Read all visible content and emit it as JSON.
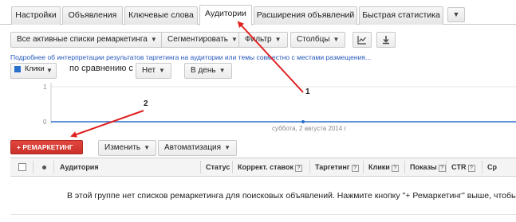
{
  "tabs": [
    {
      "label": "Настройки",
      "active": false
    },
    {
      "label": "Объявления",
      "active": false
    },
    {
      "label": "Ключевые слова",
      "active": false
    },
    {
      "label": "Аудитории",
      "active": true
    },
    {
      "label": "Расширения объявлений",
      "active": false
    },
    {
      "label": "Быстрая статистика",
      "active": false
    }
  ],
  "toolbar": {
    "filter_select": "Все активные списки ремаркетинга",
    "segment_label": "Сегментировать",
    "filter_label": "Фильтр",
    "columns_label": "Столбцы"
  },
  "info_link": "Подробнее об интерпретации результатов таргетинга на аудитории или темы совместно с местами размещения...",
  "chart_controls": {
    "metric": "Клики",
    "compare_label": "по сравнению с",
    "compare_value": "Нет",
    "period_value": "В день"
  },
  "chart_data": {
    "type": "line",
    "y_ticks": [
      "1",
      "0"
    ],
    "date_label": "суббота, 2 августа 2014 г",
    "series": [
      {
        "values": [
          0
        ]
      }
    ],
    "ylim": [
      0,
      1
    ]
  },
  "actions": {
    "remarketing_label": "+ РЕМАРКЕТИНГ",
    "edit_label": "Изменить",
    "automation_label": "Автоматизация"
  },
  "table": {
    "columns": [
      "Аудитория",
      "Статус",
      "Коррект. ставок",
      "Таргетинг",
      "Клики",
      "Показы",
      "CTR",
      "Ср"
    ],
    "empty_message": "В этой группе нет списков ремаркетинга для поисковых объявлений. Нажмите кнопку \"+ Ремаркетинг\" выше, чтобы"
  },
  "annotations": {
    "label_1": "1",
    "label_2": "2",
    "arrow_color": "#e02020"
  },
  "colors": {
    "accent_red": "#d13a32",
    "metric_blue": "#2a6fcc",
    "link_blue": "#2255bb"
  }
}
